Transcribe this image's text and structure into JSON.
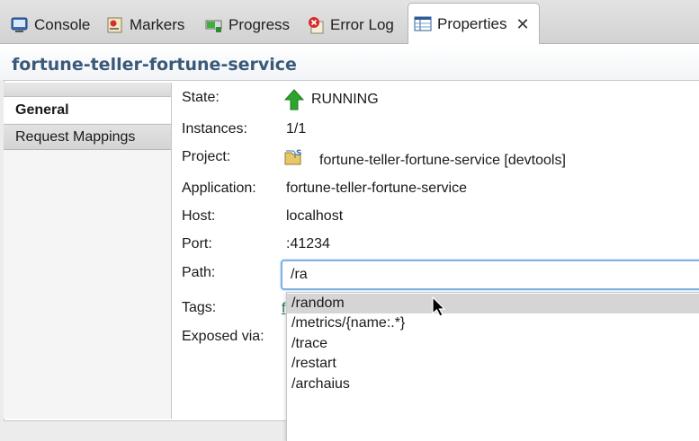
{
  "tabs": [
    {
      "label": "Console",
      "icon": "console-icon"
    },
    {
      "label": "Markers",
      "icon": "markers-icon"
    },
    {
      "label": "Progress",
      "icon": "progress-icon"
    },
    {
      "label": "Error Log",
      "icon": "error-log-icon"
    },
    {
      "label": "Properties",
      "icon": "properties-icon",
      "active": true
    }
  ],
  "header": {
    "title": "fortune-teller-fortune-service"
  },
  "sidebar": {
    "items": [
      {
        "label": "General",
        "selected": true
      },
      {
        "label": "Request Mappings",
        "selected": false
      }
    ]
  },
  "properties": {
    "state_label": "State:",
    "state_value": "RUNNING",
    "instances_label": "Instances:",
    "instances_value": "1/1",
    "project_label": "Project:",
    "project_value": "fortune-teller-fortune-service [devtools]",
    "application_label": "Application:",
    "application_value": "fortune-teller-fortune-service",
    "host_label": "Host:",
    "host_value": "localhost",
    "port_label": "Port:",
    "port_value": ":41234",
    "path_label": "Path:",
    "path_value": "/ra",
    "tags_label": "Tags:",
    "exposed_label": "Exposed via:"
  },
  "autocomplete": {
    "options": [
      "/random",
      "/metrics/{name:.*}",
      "/trace",
      "/restart",
      "/archaius"
    ],
    "selected_index": 0
  },
  "colors": {
    "header_title": "#3b5a7a",
    "running_arrow": "#2ea52e",
    "input_focus": "#7fb1e3",
    "selected_option": "#d5d5d5"
  }
}
